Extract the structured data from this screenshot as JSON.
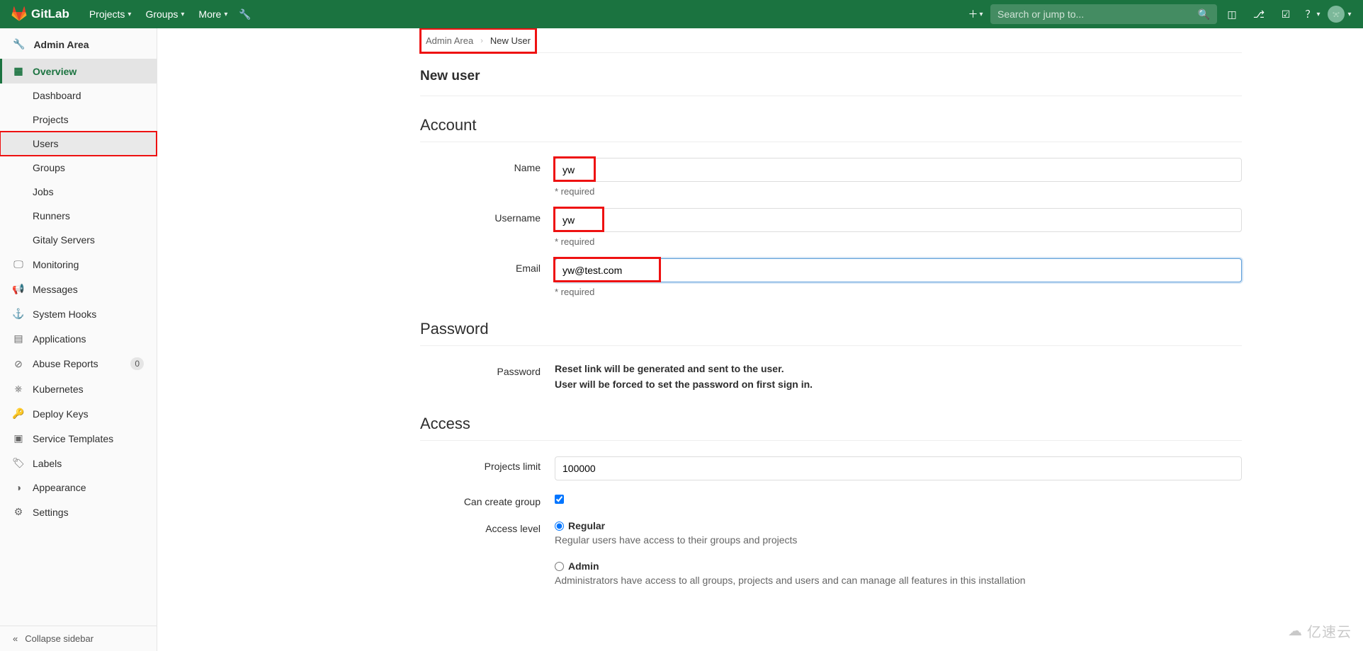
{
  "navbar": {
    "brand": "GitLab",
    "menu": {
      "projects": "Projects",
      "groups": "Groups",
      "more": "More"
    },
    "search_placeholder": "Search or jump to..."
  },
  "sidebar": {
    "context": "Admin Area",
    "overview": "Overview",
    "overview_items": {
      "dashboard": "Dashboard",
      "projects": "Projects",
      "users": "Users",
      "groups": "Groups",
      "jobs": "Jobs",
      "runners": "Runners",
      "gitaly": "Gitaly Servers"
    },
    "items": {
      "monitoring": "Monitoring",
      "messages": "Messages",
      "system_hooks": "System Hooks",
      "applications": "Applications",
      "abuse_reports": "Abuse Reports",
      "abuse_badge": "0",
      "kubernetes": "Kubernetes",
      "deploy_keys": "Deploy Keys",
      "service_templates": "Service Templates",
      "labels": "Labels",
      "appearance": "Appearance",
      "settings": "Settings"
    },
    "collapse": "Collapse sidebar"
  },
  "breadcrumb": {
    "root": "Admin Area",
    "current": "New User"
  },
  "page_title": "New user",
  "sections": {
    "account": "Account",
    "password": "Password",
    "access": "Access"
  },
  "form": {
    "name_label": "Name",
    "name_value": "yw",
    "username_label": "Username",
    "username_value": "yw",
    "email_label": "Email",
    "email_value": "yw@test.com",
    "required_hint": "* required",
    "password_label": "Password",
    "password_note1": "Reset link will be generated and sent to the user.",
    "password_note2": "User will be forced to set the password on first sign in.",
    "projects_limit_label": "Projects limit",
    "projects_limit_value": "100000",
    "can_create_group_label": "Can create group",
    "can_create_group_checked": true,
    "access_level_label": "Access level",
    "access_regular_label": "Regular",
    "access_regular_desc": "Regular users have access to their groups and projects",
    "access_admin_label": "Admin",
    "access_admin_desc": "Administrators have access to all groups, projects and users and can manage all features in this installation"
  },
  "watermark": "亿速云"
}
